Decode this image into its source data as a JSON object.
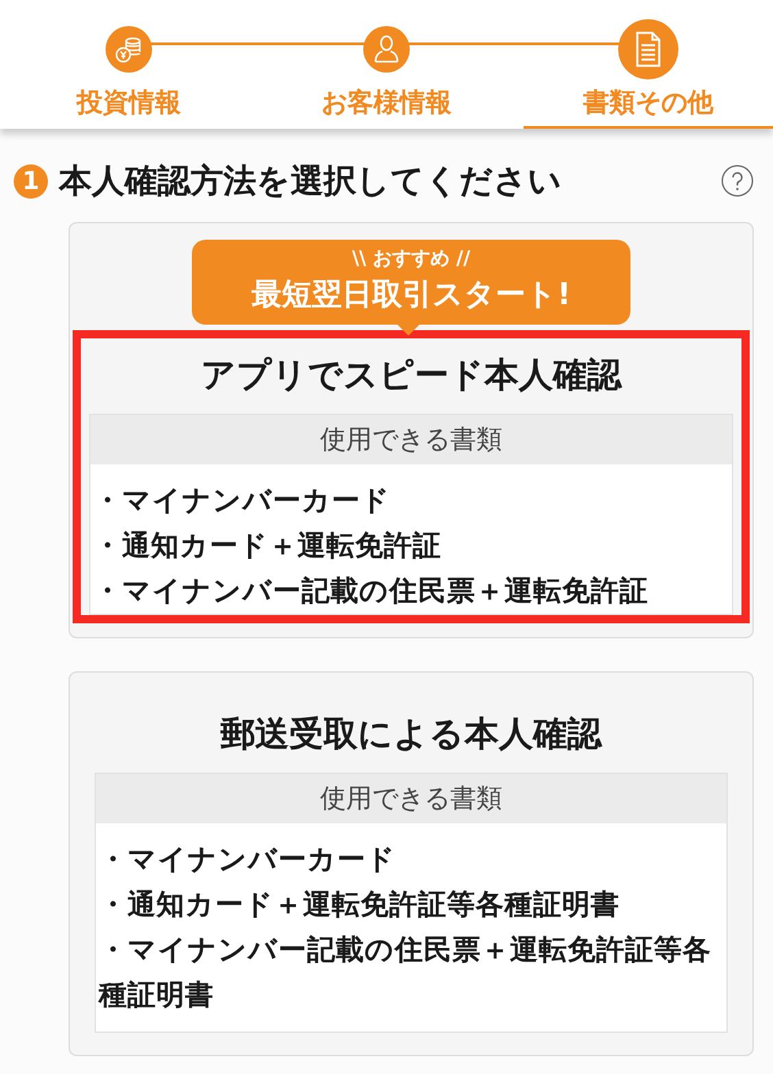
{
  "steps": [
    {
      "label": "投資情報",
      "kind": "coins",
      "selected": false
    },
    {
      "label": "お客様情報",
      "kind": "person",
      "selected": false
    },
    {
      "label": "書類その他",
      "kind": "document",
      "selected": true
    }
  ],
  "section": {
    "number": "1",
    "title": "本人確認方法を選択してください"
  },
  "methods": [
    {
      "badge": {
        "sub": "\\\\ おすすめ //",
        "main": "最短翌日取引スタート!"
      },
      "title": "アプリでスピード本人確認",
      "highlighted": true,
      "documents_header": "使用できる書類",
      "documents": [
        "・マイナンバーカード",
        "・通知カード＋運転免許証",
        "・マイナンバー記載の住民票＋運転免許証"
      ]
    },
    {
      "title": "郵送受取による本人確認",
      "highlighted": false,
      "documents_header": "使用できる書類",
      "documents": [
        "・マイナンバーカード",
        "・通知カード＋運転免許証等各種証明書",
        "・マイナンバー記載の住民票＋運転免許証等各種証明書"
      ]
    }
  ]
}
